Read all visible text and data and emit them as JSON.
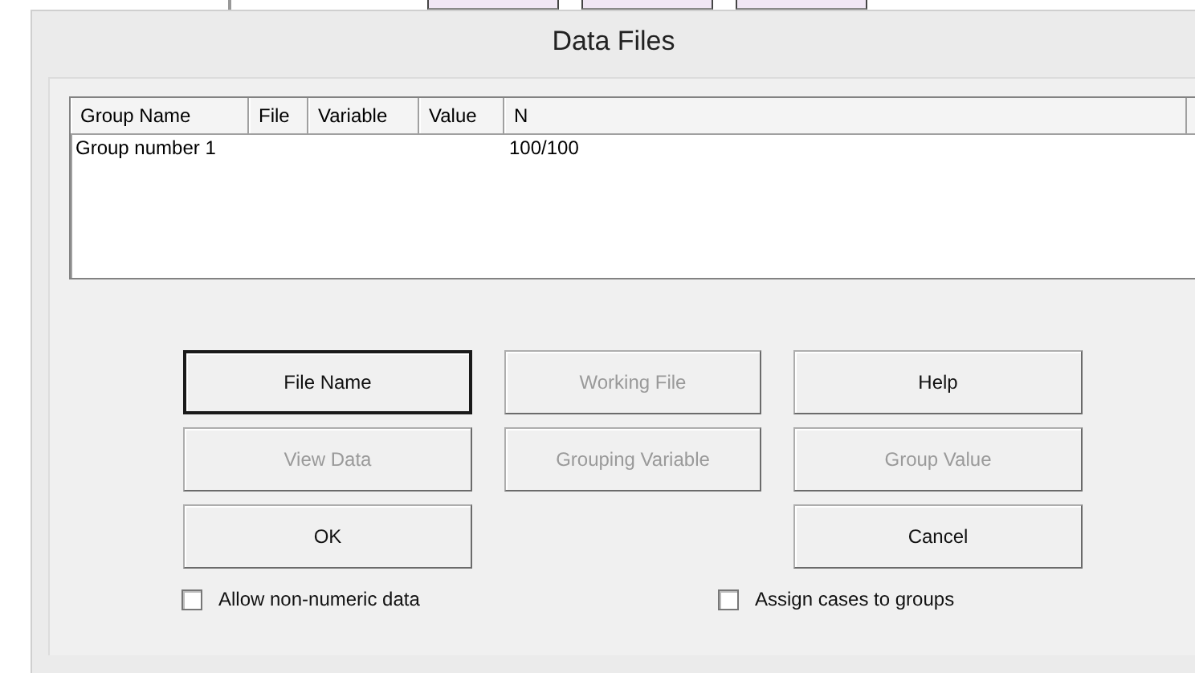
{
  "window": {
    "title": "Data Files"
  },
  "table": {
    "columns": [
      "Group Name",
      "File",
      "Variable",
      "Value",
      "N"
    ],
    "rows": [
      {
        "cells": [
          "Group number 1",
          "",
          "",
          "",
          "100/100"
        ]
      }
    ]
  },
  "button_rows": [
    [
      {
        "label": "File Name",
        "default": true,
        "disabled": false
      },
      {
        "label": "Working File",
        "default": false,
        "disabled": true
      },
      {
        "label": "Help",
        "default": false,
        "disabled": false
      }
    ],
    [
      {
        "label": "View Data",
        "default": false,
        "disabled": true
      },
      {
        "label": "Grouping Variable",
        "default": false,
        "disabled": true
      },
      {
        "label": "Group Value",
        "default": false,
        "disabled": true
      }
    ],
    [
      {
        "label": "OK",
        "default": false,
        "disabled": false
      },
      {
        "label": "Cancel",
        "default": false,
        "disabled": false
      }
    ]
  ],
  "checkboxes": [
    {
      "label": "Allow non-numeric data",
      "checked": false
    },
    {
      "label": "Assign cases to groups",
      "checked": false
    }
  ]
}
